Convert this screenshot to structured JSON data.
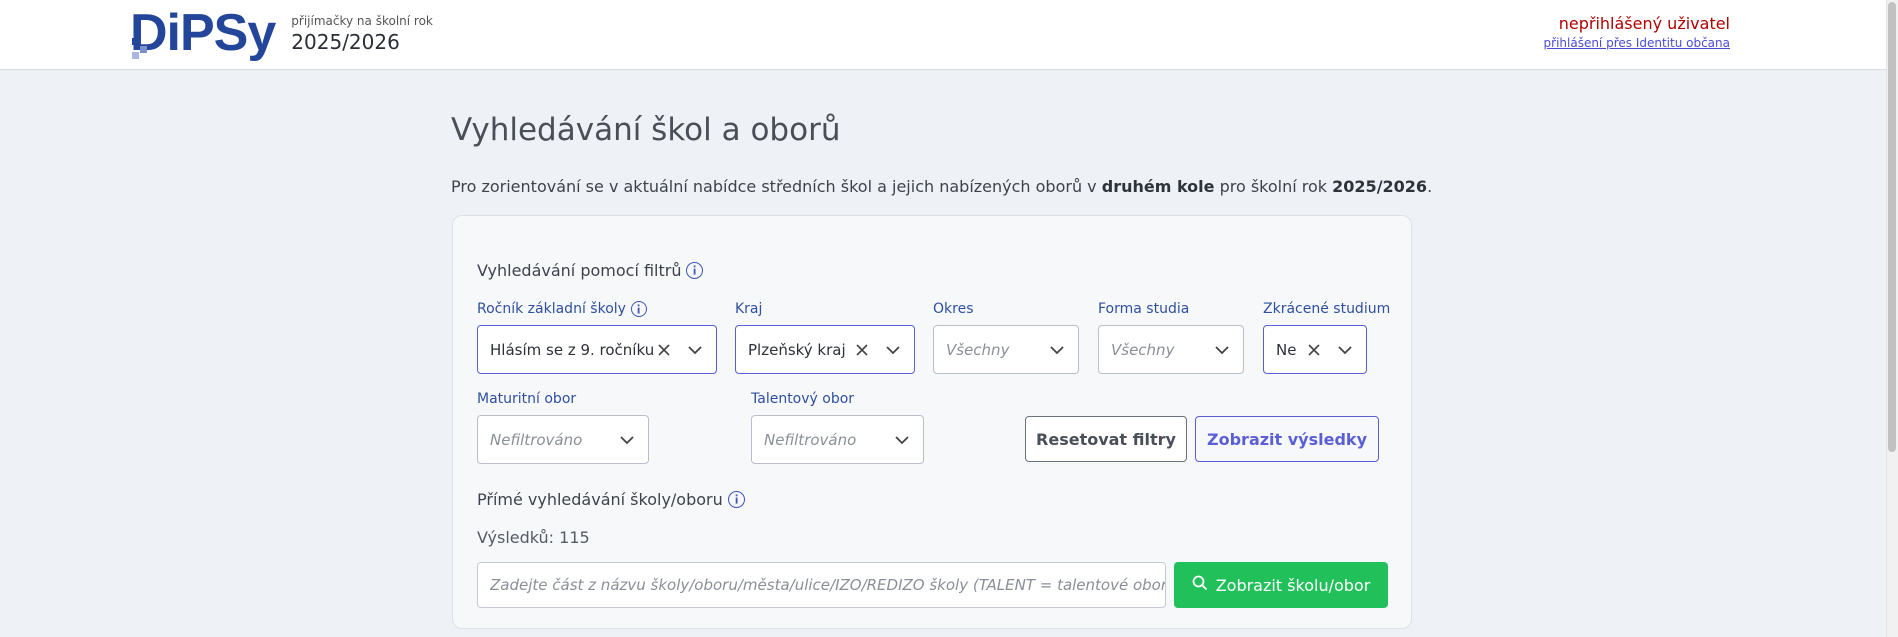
{
  "header": {
    "logo_text": "DiPSy",
    "subtitle": "přijímačky na školní rok",
    "school_year": "2025/2026",
    "user_status": "nepřihlášený uživatel",
    "login_link": "přihlášení přes Identitu občana"
  },
  "page": {
    "title": "Vyhledávání škol a oborů",
    "intro_prefix": "Pro zorientování se v aktuální nabídce středních škol a jejich nabízených oborů v ",
    "intro_bold1": "druhém kole",
    "intro_middle": " pro školní rok ",
    "intro_bold2": "2025/2026",
    "intro_suffix": "."
  },
  "filters": {
    "section_title": "Vyhledávání pomocí filtrů",
    "grade": {
      "label": "Ročník základní školy",
      "value": "Hlásím se z 9. ročníku"
    },
    "region": {
      "label": "Kraj",
      "value": "Plzeňský kraj"
    },
    "district": {
      "label": "Okres",
      "placeholder": "Všechny"
    },
    "study_form": {
      "label": "Forma studia",
      "placeholder": "Všechny"
    },
    "shortened": {
      "label": "Zkrácené studium",
      "value": "Ne"
    },
    "maturita": {
      "label": "Maturitní obor",
      "placeholder": "Nefiltrováno"
    },
    "talent": {
      "label": "Talentový obor",
      "placeholder": "Nefiltrováno"
    },
    "reset_button": "Resetovat filtry",
    "show_button": "Zobrazit výsledky"
  },
  "direct_search": {
    "section_title": "Přímé vyhledávání školy/oboru",
    "results_label": "Výsledků: 115",
    "input_placeholder": "Zadejte část z názvu školy/oboru/města/ulice/IZO/REDIZO školy (TALENT = talentové obory)",
    "button_label": "Zobrazit školu/obor"
  },
  "colors": {
    "brand": "#23459a",
    "accent": "#5b5fd6",
    "success": "#22c05a",
    "warning_text": "#b00000"
  }
}
